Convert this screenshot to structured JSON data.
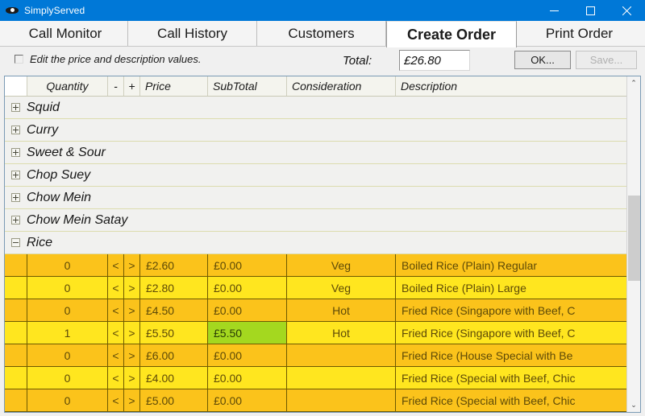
{
  "window": {
    "title": "SimplyServed",
    "icon": "app-eye-icon",
    "controls": {
      "minimize": "minimize-icon",
      "maximize": "maximize-icon",
      "close": "close-icon"
    },
    "accent_color": "#0078d7"
  },
  "tabs": [
    {
      "label": "Call Monitor",
      "active": false
    },
    {
      "label": "Call History",
      "active": false
    },
    {
      "label": "Customers",
      "active": false
    },
    {
      "label": "Create Order",
      "active": true
    },
    {
      "label": "Print Order",
      "active": false
    }
  ],
  "toolbar": {
    "edit_checkbox": {
      "label": "Edit the price and description values.",
      "checked": false
    },
    "total_label": "Total:",
    "total_value": "£26.80",
    "ok_button": "OK...",
    "save_button": "Save...",
    "save_enabled": false
  },
  "grid": {
    "columns": [
      {
        "key": "indicator",
        "label": ""
      },
      {
        "key": "quantity",
        "label": "Quantity"
      },
      {
        "key": "minus",
        "label": "-"
      },
      {
        "key": "plus",
        "label": "+"
      },
      {
        "key": "price",
        "label": "Price"
      },
      {
        "key": "subtotal",
        "label": "SubTotal"
      },
      {
        "key": "consideration",
        "label": "Consideration"
      },
      {
        "key": "description",
        "label": "Description"
      }
    ],
    "stepper": {
      "down": "<",
      "up": ">"
    },
    "groups": [
      {
        "label": "Squid",
        "expanded": false
      },
      {
        "label": "Curry",
        "expanded": false
      },
      {
        "label": "Sweet & Sour",
        "expanded": false
      },
      {
        "label": "Chop Suey",
        "expanded": false
      },
      {
        "label": "Chow Mein",
        "expanded": false
      },
      {
        "label": "Chow Mein Satay",
        "expanded": false
      },
      {
        "label": "Rice",
        "expanded": true
      }
    ],
    "rows": [
      {
        "quantity": "0",
        "price": "£2.60",
        "subtotal": "£0.00",
        "consideration": "Veg",
        "description": "Boiled Rice (Plain) Regular",
        "highlighted": false
      },
      {
        "quantity": "0",
        "price": "£2.80",
        "subtotal": "£0.00",
        "consideration": "Veg",
        "description": "Boiled Rice (Plain) Large",
        "highlighted": false
      },
      {
        "quantity": "0",
        "price": "£4.50",
        "subtotal": "£0.00",
        "consideration": "Hot",
        "description": "Fried Rice (Singapore with Beef, C",
        "highlighted": false
      },
      {
        "quantity": "1",
        "price": "£5.50",
        "subtotal": "£5.50",
        "consideration": "Hot",
        "description": "Fried Rice (Singapore with Beef, C",
        "highlighted": true
      },
      {
        "quantity": "0",
        "price": "£6.00",
        "subtotal": "£0.00",
        "consideration": "",
        "description": "Fried Rice (House Special with Be",
        "highlighted": false
      },
      {
        "quantity": "0",
        "price": "£4.00",
        "subtotal": "£0.00",
        "consideration": "",
        "description": "Fried Rice (Special with Beef, Chic",
        "highlighted": false
      },
      {
        "quantity": "0",
        "price": "£5.00",
        "subtotal": "£0.00",
        "consideration": "",
        "description": "Fried Rice (Special with Beef, Chic",
        "highlighted": false
      }
    ],
    "scrollbar": {
      "up": "⌃",
      "down": "⌄"
    },
    "colors": {
      "row_odd": "#fbc31b",
      "row_even": "#ffe61f",
      "row_highlight": "#a4d81f",
      "grid_line": "#6e5a00"
    }
  }
}
